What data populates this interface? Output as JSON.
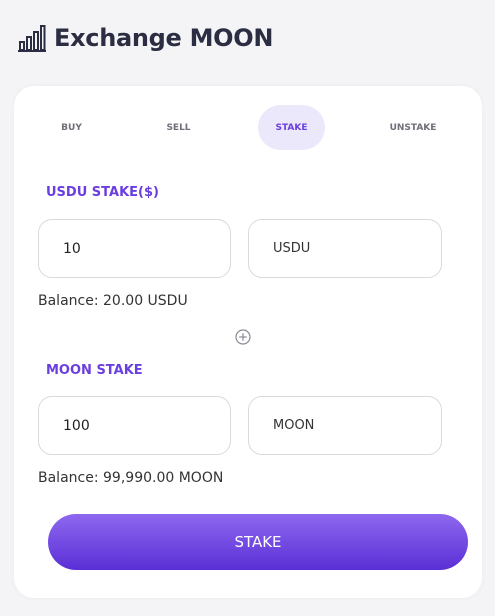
{
  "app": {
    "title": "Exchange MOON"
  },
  "tabs": [
    {
      "label": "BUY"
    },
    {
      "label": "SELL"
    },
    {
      "label": "STAKE",
      "active": true
    },
    {
      "label": "UNSTAKE"
    }
  ],
  "usdu": {
    "label": "USDU STAKE($)",
    "value": "10",
    "unit": "USDU",
    "balance_prefix": "Balance:",
    "balance_value": "20.00 USDU"
  },
  "moon": {
    "label": "MOON STAKE",
    "value": "100",
    "unit": "MOON",
    "balance_prefix": "Balance:",
    "balance_value": "99,990.00 MOON"
  },
  "actions": {
    "stake_label": "STAKE"
  },
  "icons": {
    "logo": "bar-chart-icon",
    "separator": "plus-circle-icon"
  },
  "colors": {
    "accent": "#6a3ee0",
    "tab_active_bg": "#ece8fb",
    "button_top": "#8e67ef",
    "button_bottom": "#5a30d6"
  }
}
